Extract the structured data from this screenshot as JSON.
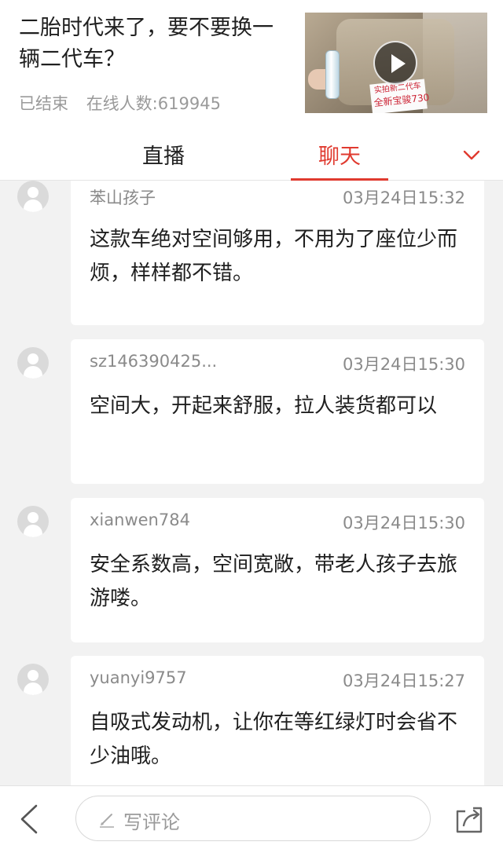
{
  "header": {
    "title": "二胎时代来了，要不要换一辆二代车？",
    "status": "已结束",
    "online_label": "在线人数:619945",
    "thumbnail": {
      "sign_line1": "实拍新二代车",
      "sign_line2": "全新宝骏730"
    }
  },
  "tabs": [
    {
      "label": "直播",
      "active": false
    },
    {
      "label": "聊天",
      "active": true
    }
  ],
  "accent_color": "#e03a2f",
  "messages": [
    {
      "user": "苯山孩子",
      "time": "03月24日15:32",
      "text": "这款车绝对空间够用，不用为了座位少而烦，样样都不错。"
    },
    {
      "user": "sz146390425...",
      "time": "03月24日15:30",
      "text": "空间大，开起来舒服，拉人装货都可以"
    },
    {
      "user": "xianwen784",
      "time": "03月24日15:30",
      "text": "安全系数高，空间宽敞，带老人孩子去旅游喽。"
    },
    {
      "user": "yuanyi9757",
      "time": "03月24日15:27",
      "text": "自吸式发动机，让你在等红绿灯时会省不少油哦。"
    }
  ],
  "bottom_bar": {
    "comment_placeholder": "写评论",
    "icons": [
      "back-icon",
      "pen-icon",
      "share-icon"
    ]
  }
}
